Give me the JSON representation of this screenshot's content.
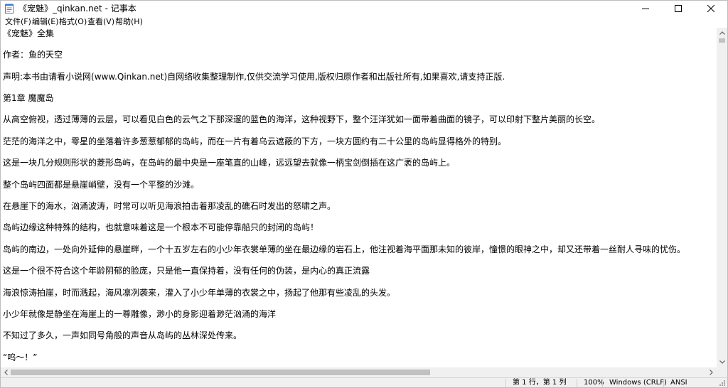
{
  "window": {
    "title": "《宠魅》_qinkan.net - 记事本",
    "icon": "notepad-icon"
  },
  "menu": [
    {
      "label": "文件(F)"
    },
    {
      "label": "编辑(E)"
    },
    {
      "label": "格式(O)"
    },
    {
      "label": "查看(V)"
    },
    {
      "label": "帮助(H)"
    }
  ],
  "document": {
    "lines": [
      "《宠魅》全集",
      "作者：鱼的天空",
      "声明:本书由请看小说网(www.Qinkan.net)自网络收集整理制作,仅供交流学习使用,版权归原作者和出版社所有,如果喜欢,请支持正版.",
      "第1章  魔魔岛",
      "从高空俯视，透过薄薄的云层，可以看见白色的云气之下那深邃的蓝色的海洋，这种视野下，整个汪洋犹如一面带着曲面的镜子，可以印射下整片美丽的长空。",
      "茫茫的海洋之中，零星的坐落着许多葱葱郁郁的岛屿，而在一片有着乌云遮蔽的下方，一块方圆约有二十公里的岛屿显得格外的特别。",
      "这是一块几分规则形状的菱形岛屿，在岛屿的最中央是一座笔直的山峰，远远望去就像一柄宝剑倒插在这广袤的岛屿上。",
      "整个岛屿四面都是悬崖峭壁，没有一个平整的沙滩。",
      "在悬崖下的海水，汹涌波涛，时常可以听见海浪拍击着那凌乱的礁石时发出的怒啸之声。",
      "岛屿边缘这种特殊的结构，也就意味着这是一个根本不可能停靠船只的封闭的岛屿！",
      "岛屿的南边，一处向外延伸的悬崖畔，一个十五岁左右的小少年衣裳单薄的坐在最边缘的岩石上，他注视着海平面那未知的彼岸，憧憬的眼神之中，却又还带着一丝耐人寻味的忧伤。",
      "这是一个很不符合这个年龄阴郁的脸庞，只是他一直保持着，没有任何的伪装，是内心的真正流露",
      "海浪惊涛拍崖，时而溅起，海风凛冽袭来，灌入了小少年单薄的衣裳之中，扬起了他那有些凌乱的头发。",
      "小少年就像是静坐在海崖上的一尊雕像，渺小的身影迎着渺茫汹涌的海洋",
      "不知过了多久，一声如同号角般的声音从岛屿的丛林深处传来。",
      "“呜～！”"
    ]
  },
  "status": {
    "position": "第 1 行，第 1 列",
    "zoom": "100%",
    "line_ending": "Windows (CRLF)",
    "encoding": "ANSI"
  }
}
